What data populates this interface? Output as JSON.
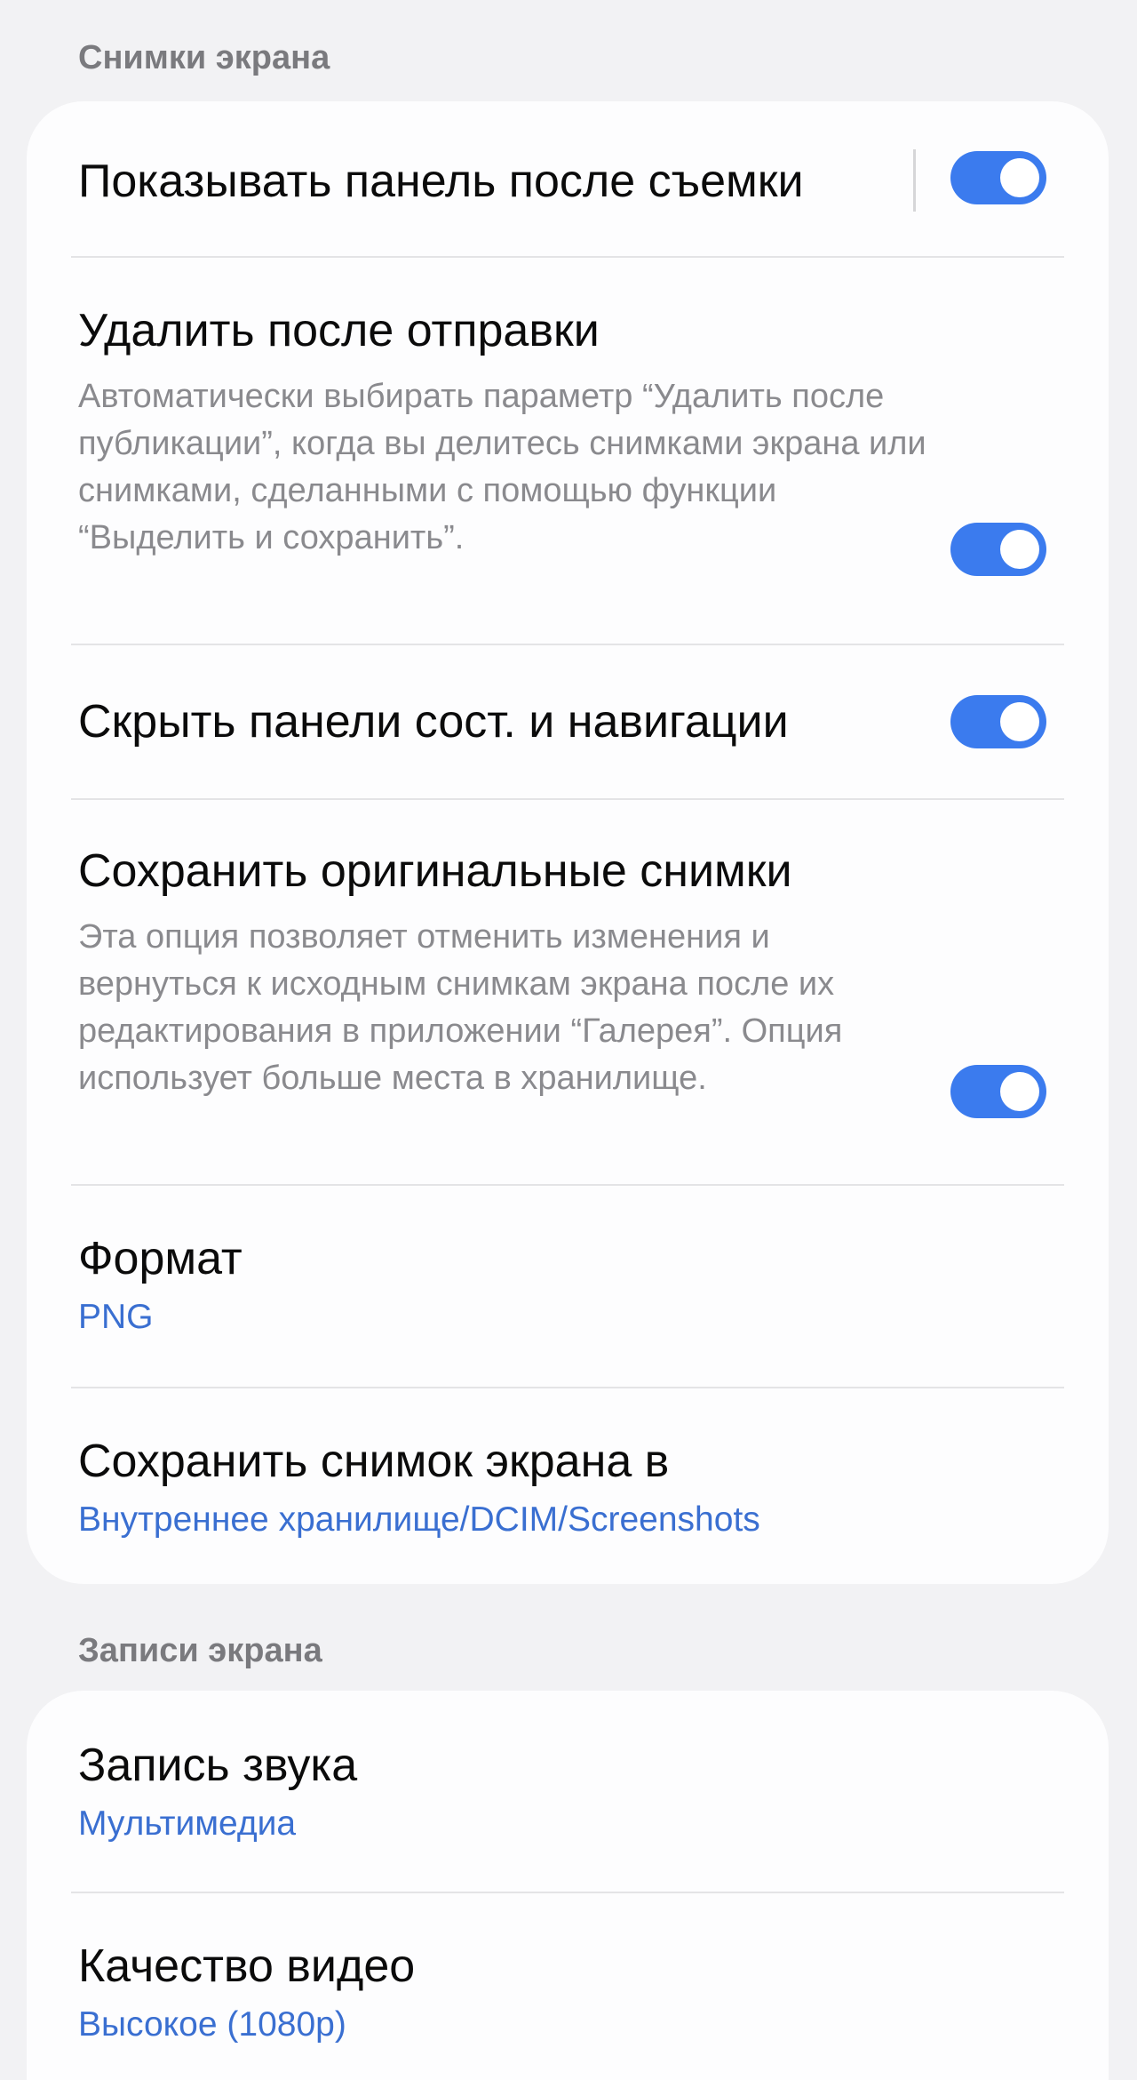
{
  "sections": {
    "screenshots": {
      "header": "Снимки экрана",
      "items": [
        {
          "title": "Показывать панель после съемки",
          "toggle": true
        },
        {
          "title": "Удалить после отправки",
          "subtitle": "Автоматически выбирать параметр “Удалить после публикации”, когда вы делитесь снимками экрана или снимками, сделанными с помощью функции “Выделить и сохранить”.",
          "toggle": true
        },
        {
          "title": "Скрыть панели сост. и навигации",
          "toggle": true
        },
        {
          "title": "Сохранить оригинальные снимки",
          "subtitle": "Эта опция позволяет отменить изменения и вернуться к исходным снимкам экрана после их редактирования в приложении “Галерея”. Опция использует больше места в хранилище.",
          "toggle": true
        },
        {
          "title": "Формат",
          "value": "PNG"
        },
        {
          "title": "Сохранить снимок экрана в",
          "value": "Внутреннее хранилище/DCIM/Screenshots"
        }
      ]
    },
    "recordings": {
      "header": "Записи экрана",
      "items": [
        {
          "title": "Запись звука",
          "value": "Мультимедиа"
        },
        {
          "title": "Качество видео",
          "value": "Высокое (1080p)"
        }
      ]
    }
  },
  "colors": {
    "accent": "#3b7bee",
    "value_text": "#3a6fd1",
    "background": "#f2f2f4",
    "card": "#fdfdfe"
  },
  "icons": {
    "toggle": "toggle-switch-on"
  }
}
